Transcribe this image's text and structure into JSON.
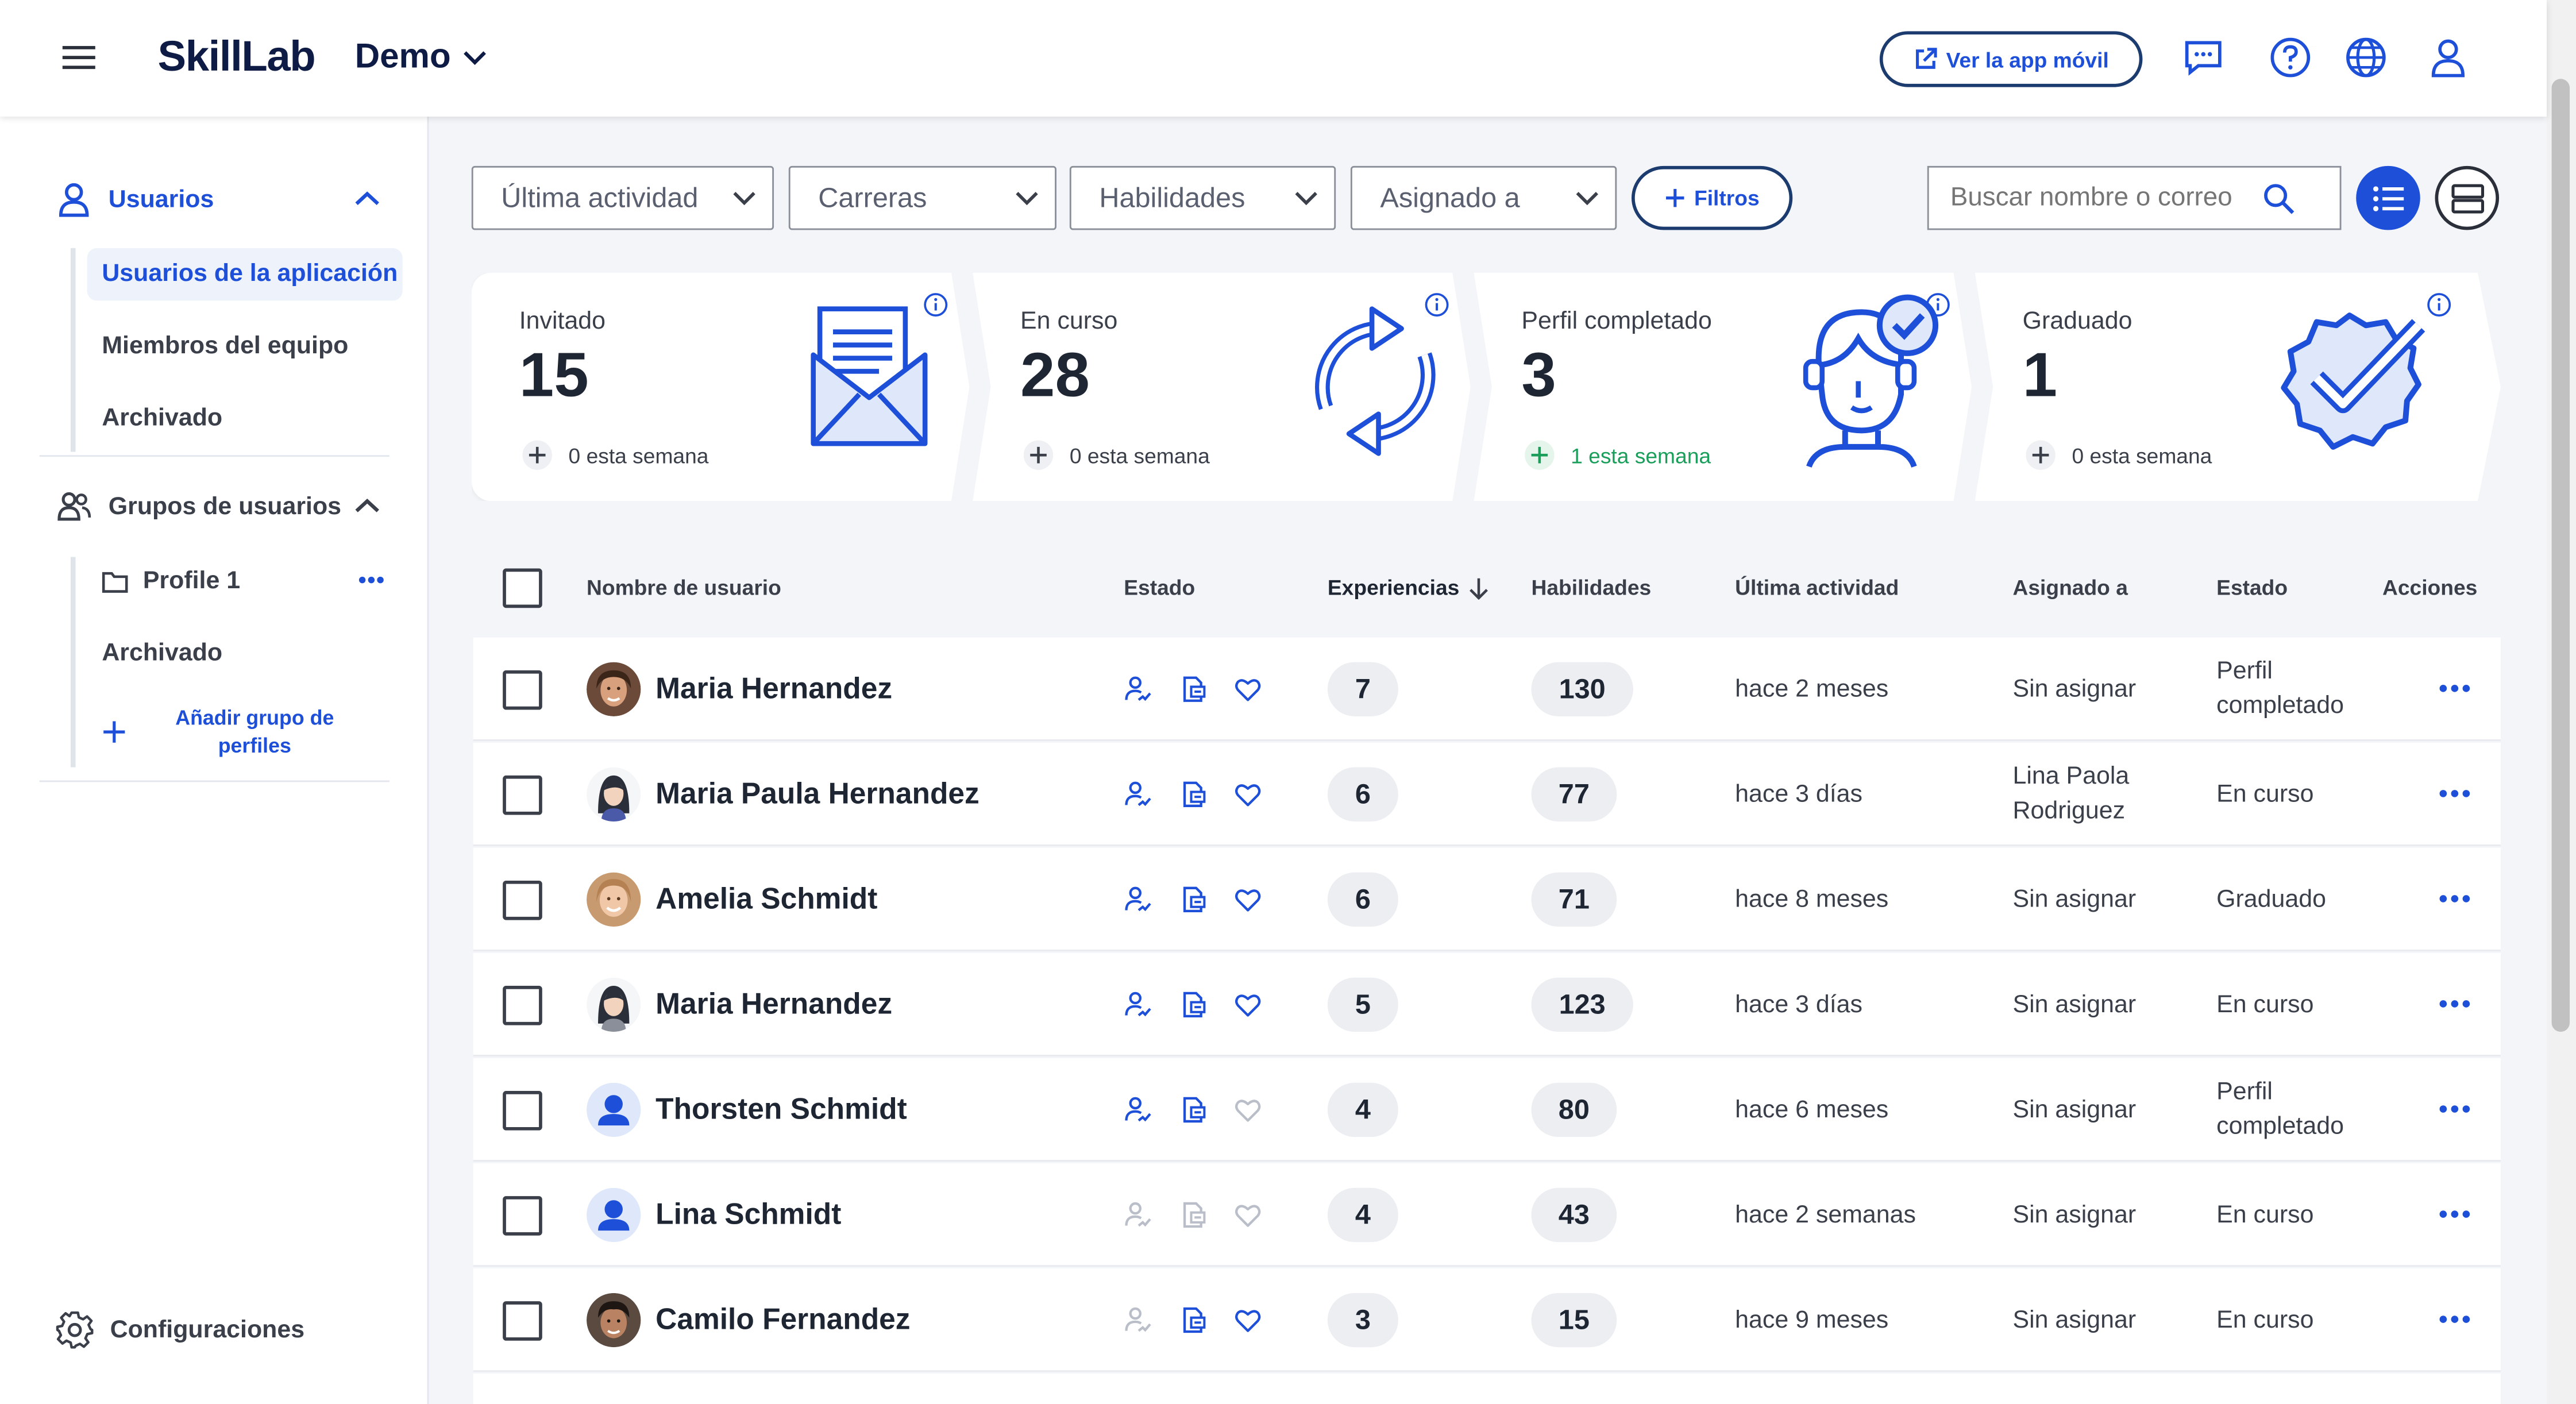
{
  "header": {
    "logo": "SkillLab",
    "org": "Demo",
    "mobile_btn": "Ver la app móvil"
  },
  "sidebar": {
    "users_title": "Usuarios",
    "users_items": [
      "Usuarios de la aplicación",
      "Miembros del equipo",
      "Archivado"
    ],
    "groups_title": "Grupos de usuarios",
    "groups_items": [
      "Profile 1",
      "Archivado"
    ],
    "add_group": "Añadir grupo de perfiles",
    "settings": "Configuraciones"
  },
  "toolbar": {
    "filters": [
      "Última actividad",
      "Carreras",
      "Habilidades",
      "Asignado a"
    ],
    "filtros_btn": "Filtros",
    "search_placeholder": "Buscar nombre o correo"
  },
  "stats": [
    {
      "label": "Invitado",
      "value": "15",
      "week": "0 esta semana",
      "icon": "envelope-icon"
    },
    {
      "label": "En curso",
      "value": "28",
      "week": "0 esta semana",
      "icon": "sync-icon"
    },
    {
      "label": "Perfil completado",
      "value": "3",
      "week": "1 esta semana",
      "icon": "profile-check-icon"
    },
    {
      "label": "Graduado",
      "value": "1",
      "week": "0 esta semana",
      "icon": "badge-check-icon"
    }
  ],
  "table": {
    "headers": [
      "Nombre de usuario",
      "Estado",
      "Experiencias",
      "Habilidades",
      "Última actividad",
      "Asignado a",
      "Estado",
      "Acciones"
    ],
    "rows": [
      {
        "name": "Maria Hernandez",
        "exp": "7",
        "skills": "130",
        "activity": "hace 2 meses",
        "assigned": "Sin asignar",
        "status": "Perfil completado"
      },
      {
        "name": "Maria Paula Hernandez",
        "exp": "6",
        "skills": "77",
        "activity": "hace 3 días",
        "assigned": "Lina Paola Rodriguez",
        "status": "En curso"
      },
      {
        "name": "Amelia Schmidt",
        "exp": "6",
        "skills": "71",
        "activity": "hace 8 meses",
        "assigned": "Sin asignar",
        "status": "Graduado"
      },
      {
        "name": "Maria Hernandez",
        "exp": "5",
        "skills": "123",
        "activity": "hace 3 días",
        "assigned": "Sin asignar",
        "status": "En curso"
      },
      {
        "name": "Thorsten Schmidt",
        "exp": "4",
        "skills": "80",
        "activity": "hace 6 meses",
        "assigned": "Sin asignar",
        "status": "Perfil completado"
      },
      {
        "name": "Lina Schmidt",
        "exp": "4",
        "skills": "43",
        "activity": "hace 2 semanas",
        "assigned": "Sin asignar",
        "status": "En curso"
      },
      {
        "name": "Camilo Fernandez",
        "exp": "3",
        "skills": "15",
        "activity": "hace 9 meses",
        "assigned": "Sin asignar",
        "status": "En curso"
      }
    ]
  },
  "colors": {
    "accent": "#1d4fd8",
    "navy": "#0e1b44",
    "green": "#1a9f5b"
  }
}
